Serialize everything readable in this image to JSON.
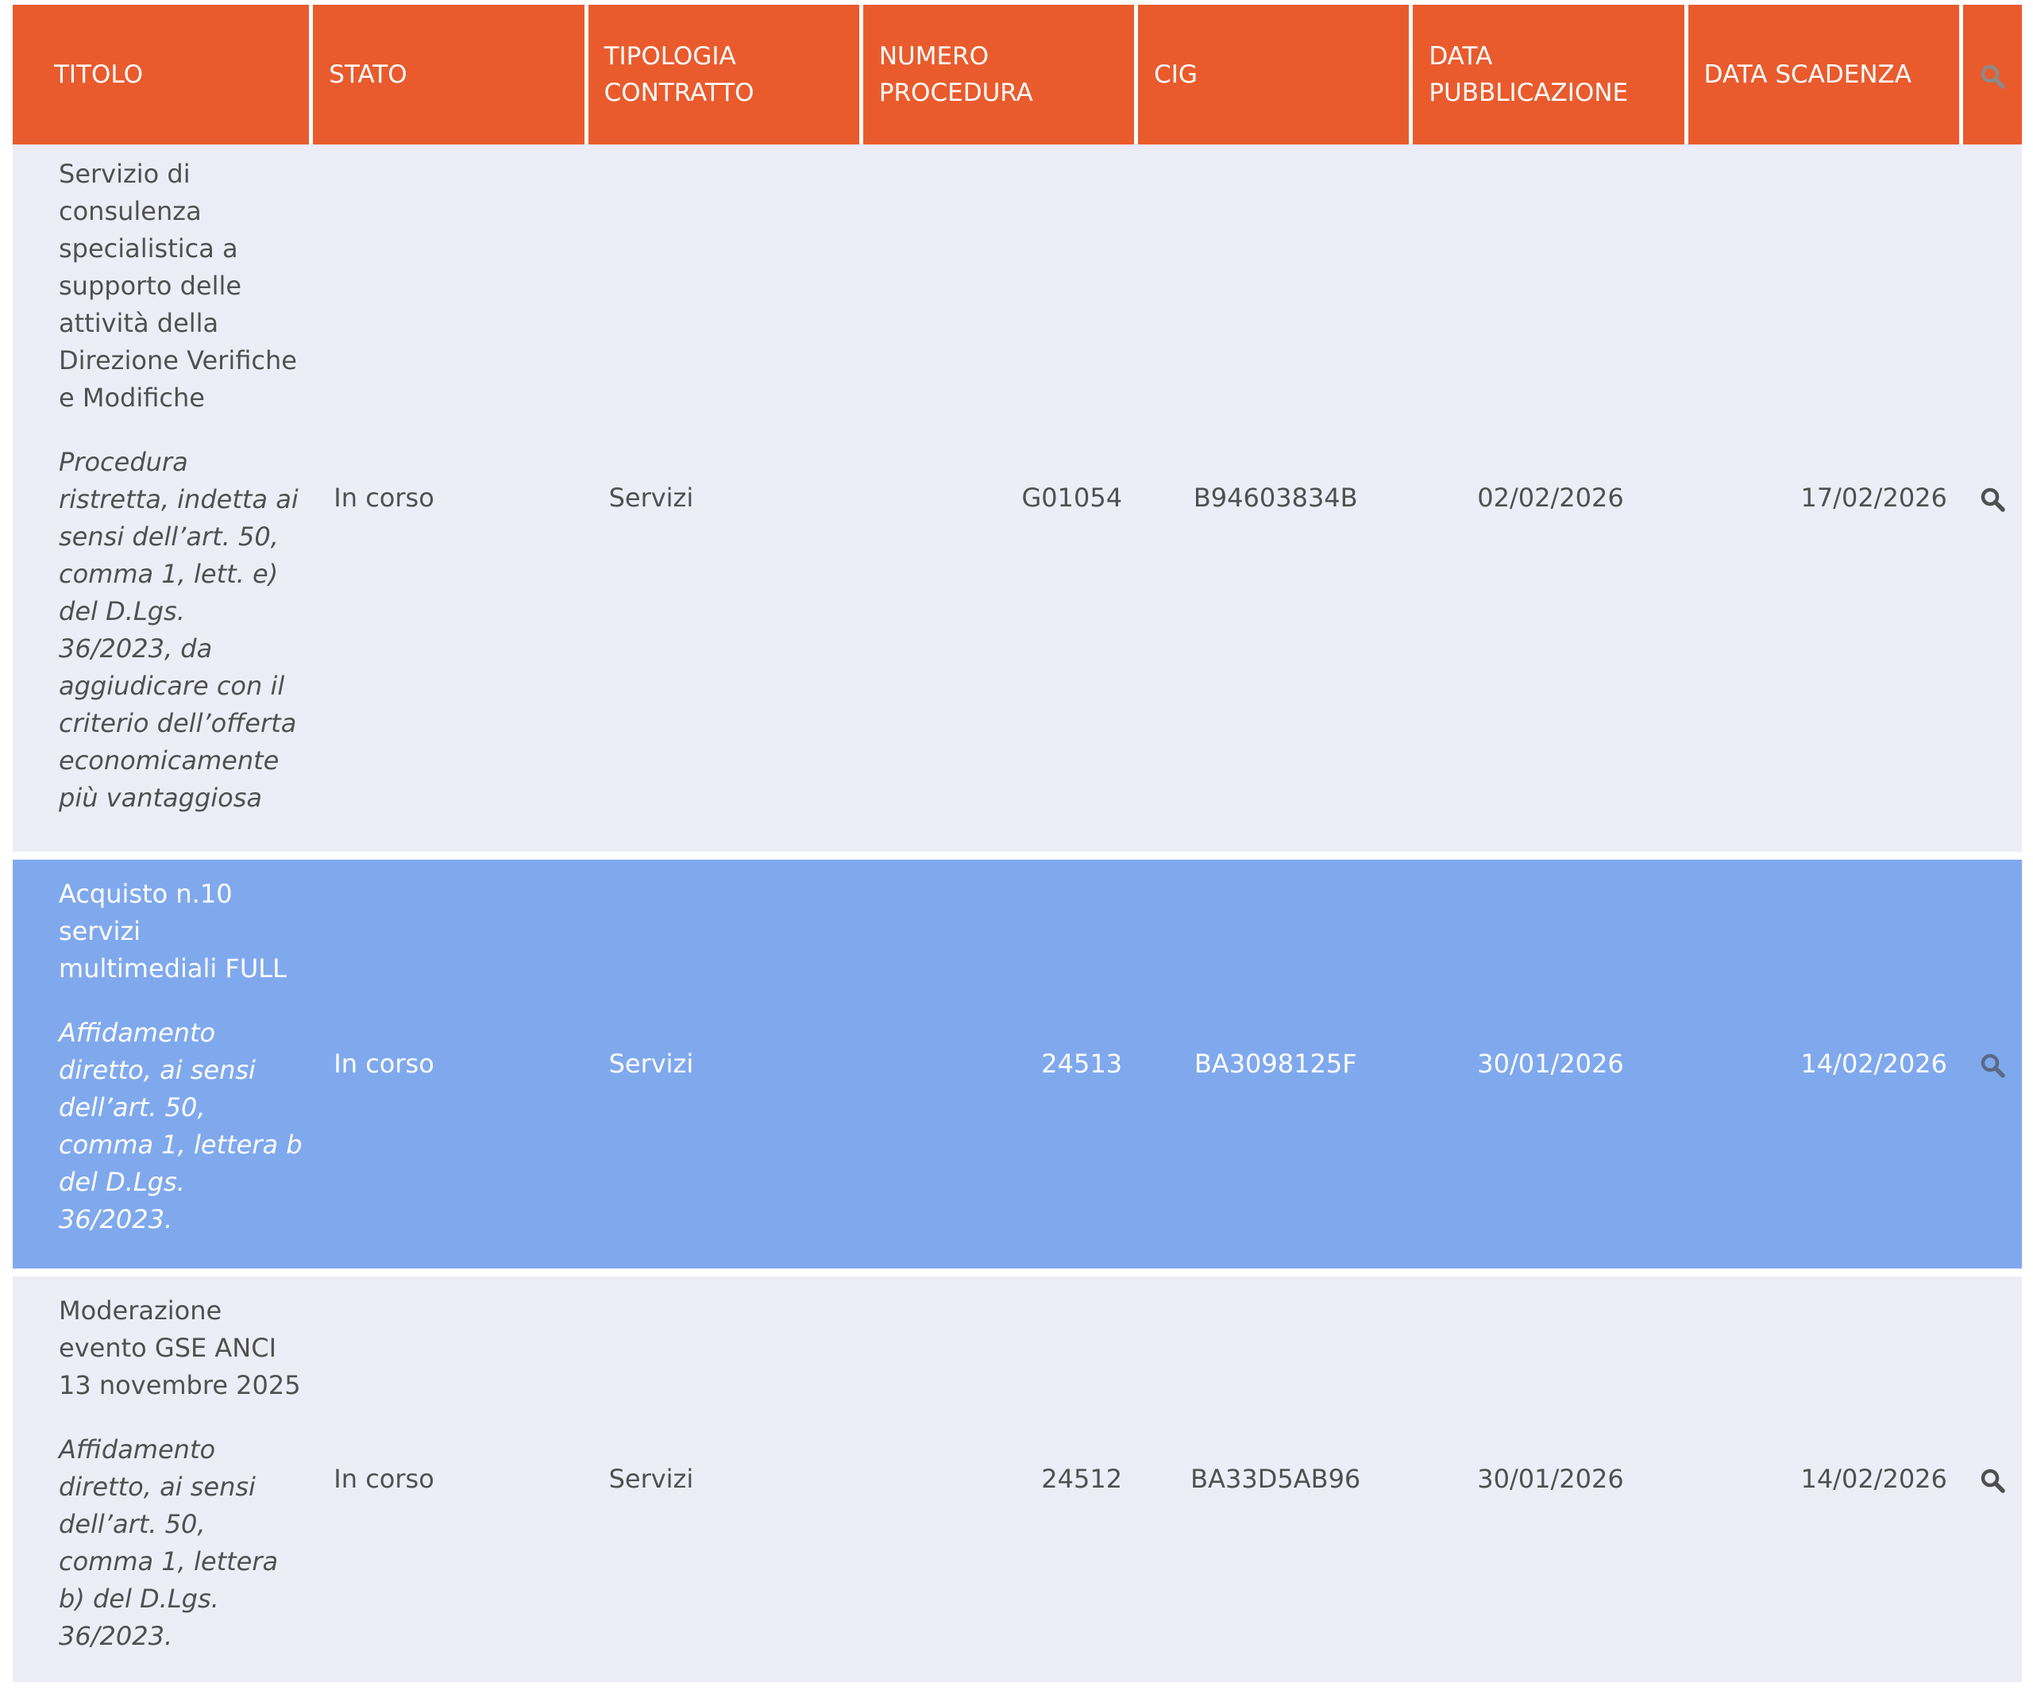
{
  "table": {
    "headers": {
      "titolo": "TITOLO",
      "stato": "STATO",
      "tipologia": "TIPOLOGIA CONTRATTO",
      "numero": "NUMERO PROCEDURA",
      "cig": "CIG",
      "data_pubblicazione": "DATA PUBBLICAZIONE",
      "data_scadenza": "DATA SCADENZA",
      "search_icon": "search-icon"
    },
    "rows": [
      {
        "titolo": "Servizio di consulenza specialistica a supporto delle attività della Direzione Verifiche e Modifiche",
        "descrizione": "Procedura ristretta, indetta ai sensi dell’art. 50, comma 1, lett. e) del D.Lgs. 36/2023, da aggiudicare con il criterio dell’offerta economicamente più vantaggiosa",
        "stato": "In corso",
        "tipologia": "Servizi",
        "numero": "G01054",
        "cig": "B94603834B",
        "data_pubblicazione": "02/02/2026",
        "data_scadenza": "17/02/2026"
      },
      {
        "titolo": "Acquisto n.10 servizi multimediali FULL",
        "descrizione": "Affidamento diretto, ai sensi dell’art. 50, comma 1, lettera b del D.Lgs. 36/2023.",
        "stato": "In corso",
        "tipologia": "Servizi",
        "numero": "24513",
        "cig": "BA3098125F",
        "data_pubblicazione": "30/01/2026",
        "data_scadenza": "14/02/2026"
      },
      {
        "titolo": "Moderazione evento GSE ANCI 13 novembre 2025",
        "descrizione": "Affidamento diretto, ai sensi dell’art. 50, comma 1, lettera b) del D.Lgs. 36/2023.",
        "stato": "In corso",
        "tipologia": "Servizi",
        "numero": "24512",
        "cig": "BA33D5AB96",
        "data_pubblicazione": "30/01/2026",
        "data_scadenza": "14/02/2026"
      }
    ]
  },
  "colors": {
    "header_bg": "#e95b2d",
    "header_text": "#ffffff",
    "row_bg": "#ededf8",
    "row_highlight_bg": "#80a9ed",
    "body_text": "#505050",
    "header_icon": "#8a8a8a",
    "row_icon": "#505050",
    "row_highlight_icon": "#5a6a86"
  }
}
